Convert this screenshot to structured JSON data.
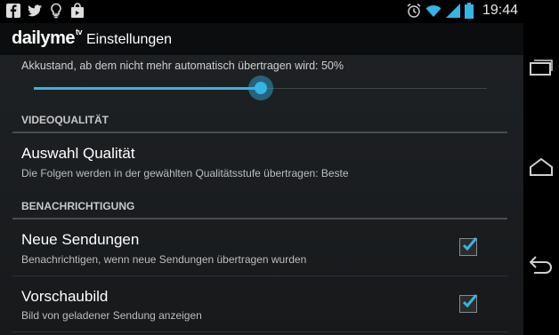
{
  "statusbar": {
    "time": "19:44",
    "left_icons": [
      "facebook-icon",
      "twitter-icon",
      "lightbulb-icon",
      "shopping-bag-icon"
    ],
    "right_icons": [
      "alarm-icon",
      "wifi-icon",
      "signal-icon",
      "battery-icon"
    ]
  },
  "actionbar": {
    "logo_text": "dailyme",
    "logo_sup": "tv",
    "title": "Einstellungen"
  },
  "slider": {
    "label": "Akkustand, ab dem nicht mehr automatisch übertragen wird: 50%",
    "value_percent": 50
  },
  "sections": [
    {
      "header": "VIDEOQUALITÄT",
      "prefs": [
        {
          "title": "Auswahl Qualität",
          "summary": "Die Folgen werden in der gewählten Qualitätsstufe übertragen: Beste"
        }
      ]
    },
    {
      "header": "BENACHRICHTIGUNG",
      "prefs": [
        {
          "title": "Neue Sendungen",
          "summary": "Benachrichtigen, wenn neue Sendungen übertragen wurden",
          "checked": true
        },
        {
          "title": "Vorschaubild",
          "summary": "Bild von geladener Sendung anzeigen",
          "checked": true
        }
      ]
    }
  ],
  "navbar": {
    "buttons": [
      "recent-apps-icon",
      "home-icon",
      "back-icon"
    ]
  },
  "colors": {
    "accent": "#33b5e5",
    "background": "#1b1d20"
  }
}
